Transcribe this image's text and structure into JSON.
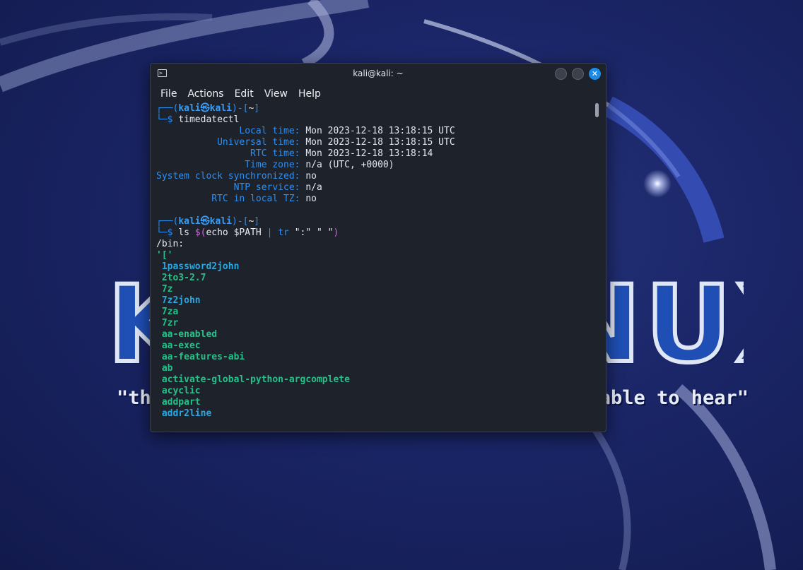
{
  "wallpaper": {
    "title": "KALI LINUX",
    "quote": "\"the quieter you become, the more you are able to hear\""
  },
  "window": {
    "title": "kali@kali: ~",
    "menu": [
      "File",
      "Actions",
      "Edit",
      "View",
      "Help"
    ]
  },
  "terminal": {
    "prompt1": {
      "user": "kali",
      "at": "㉿",
      "host": "kali",
      "dir": "~",
      "command": "timedatectl"
    },
    "timedatectl": [
      {
        "label": "Local time:",
        "value": "Mon 2023-12-18 13:18:15 UTC"
      },
      {
        "label": "Universal time:",
        "value": "Mon 2023-12-18 13:18:15 UTC"
      },
      {
        "label": "RTC time:",
        "value": "Mon 2023-12-18 13:18:14"
      },
      {
        "label": "Time zone:",
        "value": "n/a (UTC, +0000)"
      },
      {
        "label": "System clock synchronized:",
        "value": "no"
      },
      {
        "label": "NTP service:",
        "value": "n/a"
      },
      {
        "label": "RTC in local TZ:",
        "value": "no"
      }
    ],
    "prompt2": {
      "user": "kali",
      "at": "㉿",
      "host": "kali",
      "dir": "~",
      "cmd_ls": "ls",
      "cmd_subst_open": "$(",
      "cmd_echo": "echo",
      "cmd_path": "$PATH",
      "cmd_pipe": "|",
      "cmd_tr": "tr",
      "cmd_arg1": "\":\"",
      "cmd_arg2": "\" \"",
      "cmd_close": ")"
    },
    "dir_header": "/bin:",
    "listing": [
      {
        "name": "'['",
        "color": "green"
      },
      {
        "name": "1password2john",
        "color": "cyan"
      },
      {
        "name": "2to3-2.7",
        "color": "green"
      },
      {
        "name": "7z",
        "color": "green"
      },
      {
        "name": "7z2john",
        "color": "cyan"
      },
      {
        "name": "7za",
        "color": "green"
      },
      {
        "name": "7zr",
        "color": "green"
      },
      {
        "name": "aa-enabled",
        "color": "green"
      },
      {
        "name": "aa-exec",
        "color": "green"
      },
      {
        "name": "aa-features-abi",
        "color": "green"
      },
      {
        "name": "ab",
        "color": "green"
      },
      {
        "name": "activate-global-python-argcomplete",
        "color": "green"
      },
      {
        "name": "acyclic",
        "color": "green"
      },
      {
        "name": "addpart",
        "color": "green"
      },
      {
        "name": "addr2line",
        "color": "cyan"
      }
    ]
  }
}
